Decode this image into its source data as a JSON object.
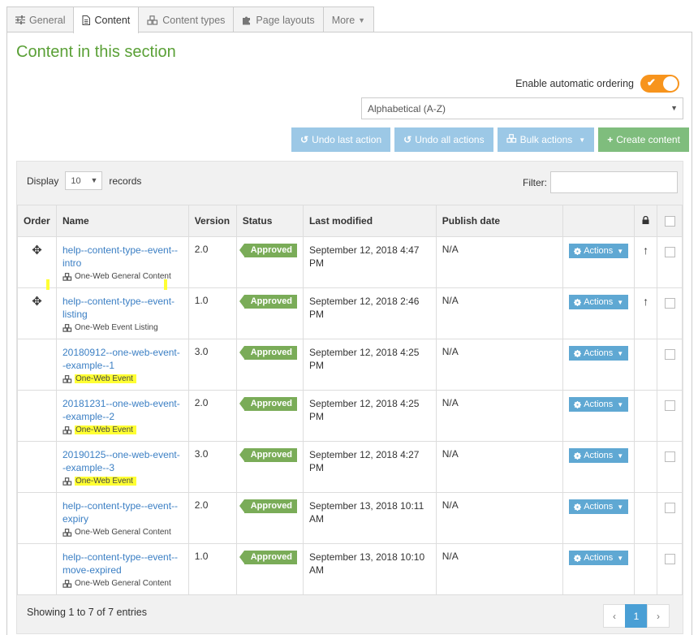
{
  "tabs": [
    {
      "label": "General",
      "icon": "sliders-icon"
    },
    {
      "label": "Content",
      "icon": "document-icon"
    },
    {
      "label": "Content types",
      "icon": "cubes-icon"
    },
    {
      "label": "Page layouts",
      "icon": "puzzle-icon"
    },
    {
      "label": "More",
      "icon": "caret-down-icon"
    }
  ],
  "section_title": "Content in this section",
  "auto_ordering": {
    "label": "Enable automatic ordering",
    "enabled": true
  },
  "sort_select": {
    "value": "Alphabetical (A-Z)"
  },
  "toolbar": {
    "undo_last": "Undo last action",
    "undo_all": "Undo all actions",
    "bulk": "Bulk actions",
    "create": "Create content"
  },
  "colors": {
    "title": "#5aa036",
    "toggle": "#f7941d",
    "approved": "#7aac58",
    "action": "#5fa8d3",
    "create": "#7fbd7d",
    "highlight": "#ffff33"
  },
  "display": {
    "prefix": "Display",
    "value": "10",
    "suffix": "records"
  },
  "filter": {
    "label": "Filter:"
  },
  "columns": {
    "order": "Order",
    "name": "Name",
    "version": "Version",
    "status": "Status",
    "modified": "Last modified",
    "publish": "Publish date"
  },
  "rows": [
    {
      "name": "help--content-type--event--intro",
      "type": "One-Web General Content",
      "version": "2.0",
      "status": "Approved",
      "modified": "September 12, 2018 4:47 PM",
      "publish": "N/A",
      "action": "Actions"
    },
    {
      "name": "help--content-type--event-listing",
      "type": "One-Web Event Listing",
      "version": "1.0",
      "status": "Approved",
      "modified": "September 12, 2018 2:46 PM",
      "publish": "N/A",
      "action": "Actions"
    },
    {
      "name": "20180912--one-web-event--example--1",
      "type": "One-Web Event",
      "version": "3.0",
      "status": "Approved",
      "modified": "September 12, 2018 4:25 PM",
      "publish": "N/A",
      "action": "Actions"
    },
    {
      "name": "20181231--one-web-event--example--2",
      "type": "One-Web Event",
      "version": "2.0",
      "status": "Approved",
      "modified": "September 12, 2018 4:25 PM",
      "publish": "N/A",
      "action": "Actions"
    },
    {
      "name": "20190125--one-web-event--example--3",
      "type": "One-Web Event",
      "version": "3.0",
      "status": "Approved",
      "modified": "September 12, 2018 4:27 PM",
      "publish": "N/A",
      "action": "Actions"
    },
    {
      "name": "help--content-type--event--expiry",
      "type": "One-Web General Content",
      "version": "2.0",
      "status": "Approved",
      "modified": "September 13, 2018 10:11 AM",
      "publish": "N/A",
      "action": "Actions"
    },
    {
      "name": "help--content-type--event--move-expired",
      "type": "One-Web General Content",
      "version": "1.0",
      "status": "Approved",
      "modified": "September 13, 2018 10:10 AM",
      "publish": "N/A",
      "action": "Actions"
    }
  ],
  "footer": {
    "showing": "Showing 1 to 7 of 7 entries",
    "page": "1"
  }
}
